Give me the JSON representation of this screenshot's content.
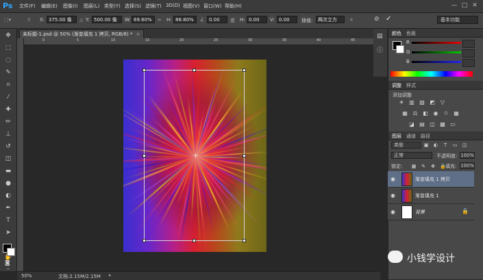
{
  "app": {
    "logo": "Ps"
  },
  "menu": [
    "文件(F)",
    "编辑(E)",
    "图像(I)",
    "图层(L)",
    "类型(Y)",
    "选择(S)",
    "滤镜(T)",
    "3D(D)",
    "视图(V)",
    "窗口(W)",
    "帮助(H)"
  ],
  "window_controls": [
    "—",
    "□",
    "✕"
  ],
  "options": {
    "x_label": "X:",
    "x_value": "375.00 像",
    "y_label": "Y:",
    "y_value": "500.00 像",
    "w_label": "W:",
    "w_value": "69.60%",
    "link_label": "∞",
    "h_label": "H:",
    "h_value": "88.80%",
    "angle_value": "0.00",
    "h2_label": "H:",
    "h2_value": "0.00",
    "v_label": "V:",
    "v_value": "0.00",
    "interp_label": "插值:",
    "interp_value": "两次立方",
    "workspace": "基本功能"
  },
  "document": {
    "tab_label": "未标题-1.psd @ 50% (渐变填充 1 拷贝, RGB/8) *",
    "tab_close": "×"
  },
  "ruler_ticks": [
    "0",
    "5",
    "10",
    "15",
    "20",
    "25",
    "30",
    "35",
    "40",
    "45"
  ],
  "status": {
    "zoom": "50%",
    "doc": "文档:2.15M/2.15M"
  },
  "color_panel": {
    "tabs": [
      "颜色",
      "色板"
    ],
    "r_label": "R",
    "g_label": "G",
    "b_label": "B"
  },
  "adjust_panel": {
    "tabs": [
      "调整",
      "样式"
    ],
    "title": "添加调整"
  },
  "layers_panel": {
    "tabs": [
      "图层",
      "通道",
      "路径"
    ],
    "kind_filter": "类型",
    "blend_mode": "正常",
    "opacity_label": "不透明度:",
    "opacity_value": "100%",
    "lock_label": "锁定:",
    "fill_label": "填充:",
    "fill_value": "100%",
    "layers": [
      {
        "name": "渐变填充 1 拷贝",
        "selected": true
      },
      {
        "name": "渐变填充 1",
        "selected": false
      },
      {
        "name": "背景",
        "selected": false
      }
    ]
  },
  "watermark": {
    "text": "小钱学设计"
  },
  "colors": {
    "accent": "#31a8ff",
    "selected_layer": "#5f6f88",
    "panel_bg": "#484848"
  }
}
